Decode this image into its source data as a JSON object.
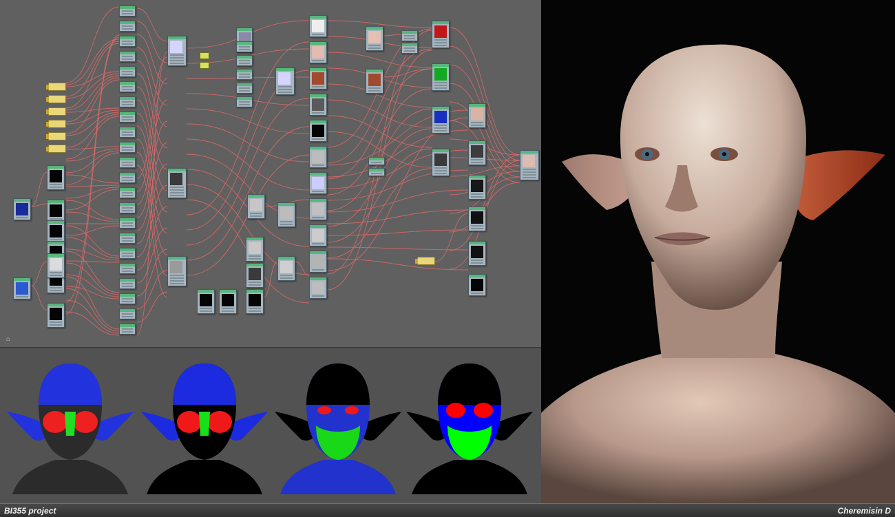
{
  "footer": {
    "project": "BI355 project",
    "author": "Cheremisin D"
  },
  "editor": {
    "corner_icon": "node-editor-icon"
  },
  "masks": [
    {
      "name": "mask-preview-1",
      "colors": [
        "#2b2b2b",
        "#2233dd",
        "#ee2020",
        "#22dd22"
      ]
    },
    {
      "name": "mask-preview-2",
      "colors": [
        "#000000",
        "#1c2be0",
        "#f01818",
        "#18e018"
      ]
    },
    {
      "name": "mask-preview-3",
      "colors": [
        "#2232cc",
        "#000000",
        "#f01818",
        "#18d818"
      ]
    },
    {
      "name": "mask-preview-4",
      "colors": [
        "#0000ff",
        "#000000",
        "#ff0000",
        "#00ff00"
      ]
    }
  ],
  "colors": {
    "node_header": "#56b77a",
    "node_body": "#a6b5bf",
    "wire": "#e06a6a",
    "editor_bg": "#606060"
  }
}
